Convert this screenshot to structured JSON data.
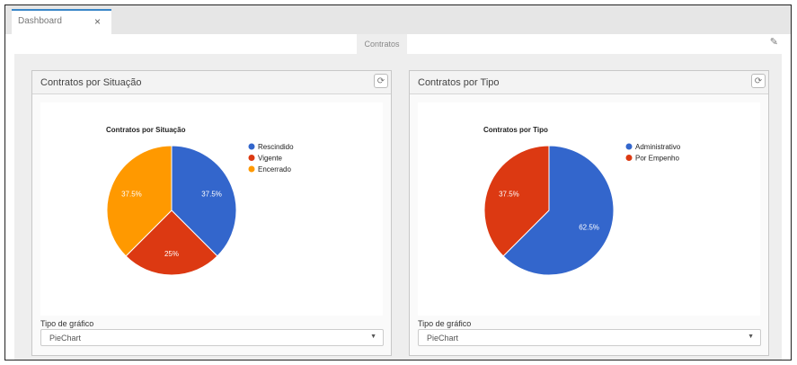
{
  "tabs": [
    {
      "label": "Dashboard",
      "close_icon": "×"
    }
  ],
  "subtab": {
    "label": "Contratos"
  },
  "edit_icon": "✎",
  "panels": [
    {
      "title": "Contratos por Situação",
      "refresh_icon": "⟳",
      "control_label": "Tipo de gráfico",
      "select_value": "PieChart"
    },
    {
      "title": "Contratos por Tipo",
      "refresh_icon": "⟳",
      "control_label": "Tipo de gráfico",
      "select_value": "PieChart"
    }
  ],
  "chart_data": [
    {
      "type": "pie",
      "title": "Contratos por Situação",
      "legend_position": "right",
      "slices": [
        {
          "label": "Rescindido",
          "value": 37.5,
          "display": "37.5%",
          "color": "#3366cc"
        },
        {
          "label": "Vigente",
          "value": 25,
          "display": "25%",
          "color": "#dc3912"
        },
        {
          "label": "Encerrado",
          "value": 37.5,
          "display": "37.5%",
          "color": "#ff9900"
        }
      ]
    },
    {
      "type": "pie",
      "title": "Contratos por Tipo",
      "legend_position": "right",
      "slices": [
        {
          "label": "Administrativo",
          "value": 62.5,
          "display": "62.5%",
          "color": "#3366cc"
        },
        {
          "label": "Por Empenho",
          "value": 37.5,
          "display": "37.5%",
          "color": "#dc3912"
        }
      ]
    }
  ]
}
